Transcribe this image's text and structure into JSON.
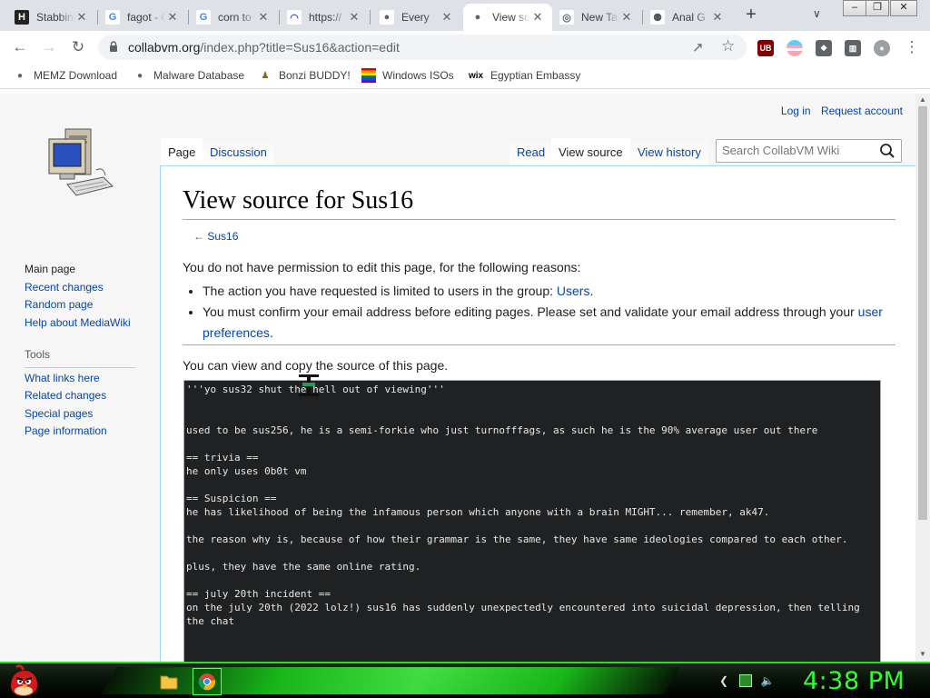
{
  "window": {
    "tabs": [
      {
        "title": "Stabbing",
        "fav_text": "H",
        "fav_bg": "#222",
        "fav_fg": "#fff"
      },
      {
        "title": "fagot - Google",
        "fav_text": "G",
        "fav_bg": "#fff",
        "fav_fg": "#4285f4"
      },
      {
        "title": "corn to",
        "fav_text": "G",
        "fav_bg": "#fff",
        "fav_fg": "#4285f4"
      },
      {
        "title": "https://",
        "fav_text": "◠",
        "fav_bg": "#fff",
        "fav_fg": "#3b4db8"
      },
      {
        "title": "Every",
        "fav_text": "●",
        "fav_bg": "#fff",
        "fav_fg": "#5f6368"
      },
      {
        "title": "View source",
        "fav_text": "●",
        "fav_bg": "#fff",
        "fav_fg": "#5f6368",
        "active": true
      },
      {
        "title": "New Tab",
        "fav_text": "◎",
        "fav_bg": "#fff",
        "fav_fg": "#5f6368"
      },
      {
        "title": "Anal G",
        "fav_text": "⚉",
        "fav_bg": "#fff",
        "fav_fg": "#555"
      }
    ],
    "new_tab": "+",
    "tab_search": "∨",
    "controls": {
      "minimize": "–",
      "maximize": "❐",
      "close": "✕"
    }
  },
  "toolbar": {
    "back": "←",
    "forward": "→",
    "reload": "↻",
    "url_host": "collabvm.org",
    "url_path": "/index.php?title=Sus16&action=edit",
    "share": "↗",
    "star": "☆",
    "extensions": [
      {
        "label": "UB",
        "bg": "#800000"
      },
      {
        "label": "",
        "bg": "#5bcefa"
      },
      {
        "label": "❖",
        "bg": "#5f6368"
      },
      {
        "label": "▥",
        "bg": "#5f6368"
      },
      {
        "label": "●",
        "bg": "#9aa0a6"
      }
    ],
    "menu": "⋮"
  },
  "bookmarks": [
    {
      "label": "MEMZ Download",
      "icon": "●",
      "color": "#5f6368"
    },
    {
      "label": "Malware Database",
      "icon": "●",
      "color": "#5f6368"
    },
    {
      "label": "Bonzi BUDDY!",
      "icon": "♟",
      "color": "#7a6a1a"
    },
    {
      "label": "Windows ISOs",
      "icon": "≡",
      "color": "#d14"
    },
    {
      "label": "Egyptian Embassy",
      "icon": "wix",
      "color": "#000"
    }
  ],
  "wiki": {
    "personal": {
      "login": "Log in",
      "request": "Request account"
    },
    "nav": [
      "Main page",
      "Recent changes",
      "Random page",
      "Help about MediaWiki"
    ],
    "tools_heading": "Tools",
    "tools": [
      "What links here",
      "Related changes",
      "Special pages",
      "Page information"
    ],
    "tabs_left": [
      {
        "label": "Page",
        "selected": true
      },
      {
        "label": "Discussion"
      }
    ],
    "tabs_right": [
      {
        "label": "Read"
      },
      {
        "label": "View source",
        "selected": true
      },
      {
        "label": "View history"
      }
    ],
    "search_placeholder": "Search CollabVM Wiki",
    "heading": "View source for Sus16",
    "backlink_arrow": "← ",
    "backlink": "Sus16",
    "no_permission": "You do not have permission to edit this page, for the following reasons:",
    "reason1_text": "The action you have requested is limited to users in the group: ",
    "reason1_link": "Users",
    "reason1_end": ".",
    "reason2_text": "You must confirm your email address before editing pages. Please set and validate your email address through your ",
    "reason2_link": "user preferences",
    "reason2_end": ".",
    "can_view": "You can view and copy the source of this page.",
    "source": "'''yo sus32 shut the hell out of viewing'''\n\n\nused to be sus256, he is a semi-forkie who just turnofffags, as such he is the 90% average user out there\n\n== trivia ==\nhe only uses 0b0t vm\n\n== Suspicion ==\nhe has likelihood of being the infamous person which anyone with a brain MIGHT... remember, ak47.\n\nthe reason why is, because of how their grammar is the same, they have same ideologies compared to each other.\n\nplus, they have the same online rating.\n\n== july 20th incident ==\non the july 20th (2022 lolz!) sus16 has suddenly unexpectedly encountered into suicidal depression, then telling the chat"
  },
  "taskbar": {
    "clock": "4:38 PM"
  }
}
